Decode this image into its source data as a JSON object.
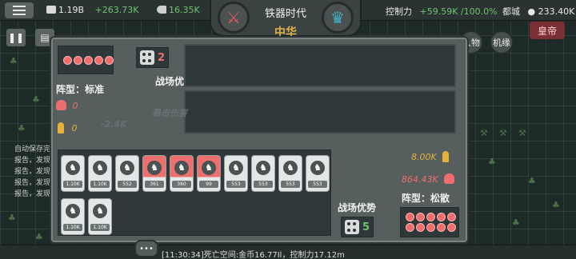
{
  "topbar": {
    "gold": "1.19B",
    "gold_rate": "+263.73K",
    "army": "16.35K",
    "era": "铁器时代",
    "nation": "中华",
    "power_label": "控制力",
    "power_change": "+59.59K /100.0%",
    "capital_label": "都城",
    "population": "233.40K",
    "emperor_button": "皇帝",
    "round_btn_1": "人物",
    "round_btn_2": "机缘"
  },
  "side_log": [
    "自动保存完",
    "报告，发现",
    "报告，发现",
    "报告，发现",
    "报告，发现"
  ],
  "battle": {
    "enemy": {
      "advantage_label": "战场优势",
      "dice_value": "2",
      "formation_label": "阵型：标准",
      "deaths": "0",
      "troops": "0",
      "dots": 5
    },
    "ghost_text_1": "-2.4K",
    "ghost_text_2": "暴击伤害",
    "player": {
      "advantage_label": "战场优势",
      "dice_value": "5",
      "formation_label": "阵型：松散",
      "troops": "8.00K",
      "deaths": "864.43K",
      "dots": 10
    },
    "units_row1": [
      {
        "hp": "1.10K",
        "hit": false
      },
      {
        "hp": "1.10K",
        "hit": false
      },
      {
        "hp": "552",
        "hit": false
      },
      {
        "hp": "361",
        "hit": true
      },
      {
        "hp": "360",
        "hit": true
      },
      {
        "hp": "99",
        "hit": true
      },
      {
        "hp": "553",
        "hit": false
      },
      {
        "hp": "553",
        "hit": false
      },
      {
        "hp": "553",
        "hit": false
      },
      {
        "hp": "553",
        "hit": false
      }
    ],
    "units_row2": [
      {
        "hp": "1.10K",
        "hit": false
      },
      {
        "hp": "1.10K",
        "hit": false
      }
    ]
  },
  "bottom_log": "[11:30:34]死亡空间:金币16.77Il，控制力17.12m",
  "colors": {
    "accent_red": "#ee6e6e",
    "accent_gold": "#e5b13a",
    "green_text": "#6ec26e"
  },
  "icons": [
    "menu-icon",
    "coin-icon",
    "arm-icon",
    "crossed-swords-icon",
    "crown-icon",
    "population-icon",
    "pause-icon",
    "save-icon",
    "dice-icon",
    "skull-icon",
    "person-icon",
    "knight-icon",
    "chat-icon"
  ]
}
